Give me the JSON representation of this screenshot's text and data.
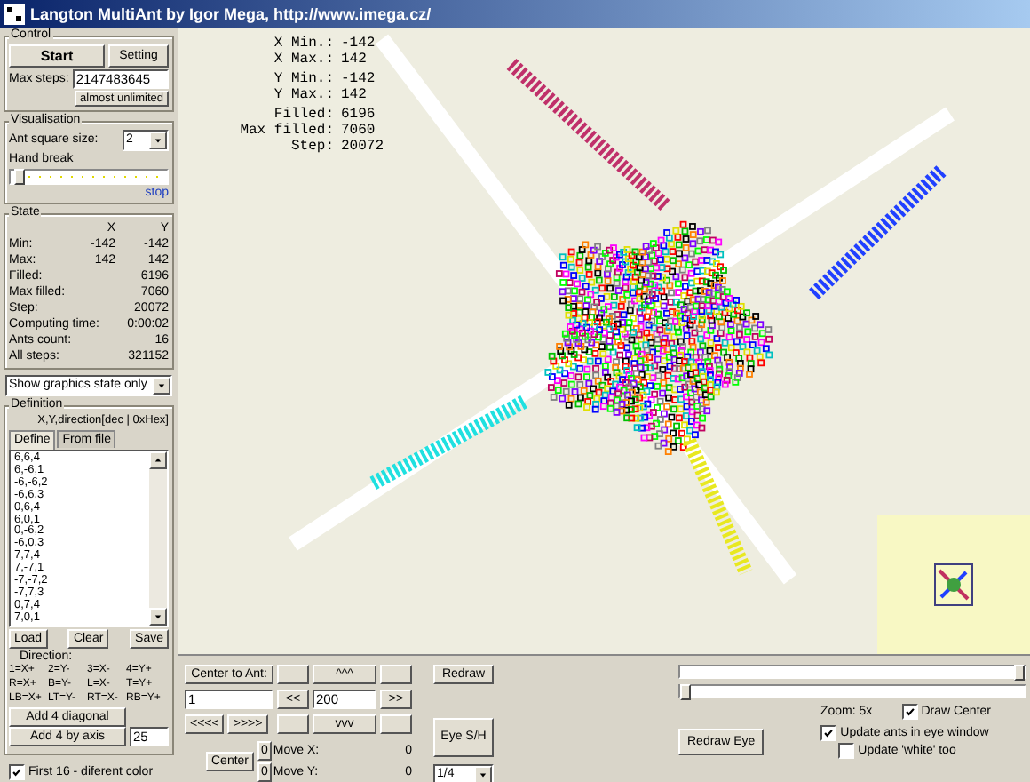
{
  "window": {
    "title": "Langton MultiAnt by Igor Mega, http://www.imega.cz/"
  },
  "control": {
    "title": "Control",
    "buttons": [
      "Start",
      "Setting"
    ],
    "max_steps": {
      "label": "Max steps:",
      "value": "2147483645"
    },
    "unlimited_button": "almost unlimited"
  },
  "visualisation": {
    "title": "Visualisation",
    "ant_size": {
      "label": "Ant square size:",
      "value": "2"
    },
    "hand_break": {
      "label": "Hand break",
      "level": 0.02,
      "link": "stop"
    }
  },
  "state": {
    "title": "State",
    "columns": [
      "X",
      "Y"
    ],
    "rows": [
      {
        "label": "Min:",
        "values": [
          "-142",
          "-142"
        ]
      },
      {
        "label": "Max:",
        "values": [
          "142",
          "142"
        ]
      },
      {
        "label": "Filled:",
        "values": [
          "6196"
        ]
      },
      {
        "label": "Max filled:",
        "values": [
          "7060"
        ]
      },
      {
        "label": "Step:",
        "values": [
          "20072"
        ]
      },
      {
        "label": "Computing time:",
        "values": [
          "0:00:02"
        ]
      },
      {
        "label": "Ants count:",
        "values": [
          "16"
        ]
      },
      {
        "label": "All steps:",
        "values": [
          "321152"
        ]
      }
    ],
    "mode": "Show graphics state only"
  },
  "definition": {
    "title": "Definition",
    "format": "X,Y,direction[dec | 0xHex]",
    "tabs": [
      {
        "label": "Define",
        "selected": true
      },
      {
        "label": "From file",
        "selected": false
      }
    ],
    "items": [
      "6,6,4",
      "6,-6,1",
      "-6,-6,2",
      "-6,6,3",
      "0,6,4",
      "6,0,1",
      "0,-6,2",
      "-6,0,3",
      "7,7,4",
      "7,-7,1",
      "-7,-7,2",
      "-7,7,3",
      "0,7,4",
      "7,0,1"
    ],
    "buttons": [
      "Load",
      "Clear",
      "Save"
    ],
    "direction_label": "Direction:",
    "directions": [
      [
        "1=X+",
        "2=Y-",
        "3=X-",
        "4=Y+"
      ],
      [
        "R=X+",
        "B=Y-",
        "L=X-",
        "T=Y+"
      ],
      [
        "LB=X+",
        "LT=Y-",
        "RT=X-",
        "RB=Y+"
      ]
    ],
    "add_buttons": [
      "Add 4 diagonal",
      "Add 4 by axis"
    ],
    "add_count": "25",
    "different_color": {
      "label": "First 16 - diferent color",
      "checked": true
    }
  },
  "canvas": {
    "stats": [
      {
        "label": "X Min.:",
        "value": "-142"
      },
      {
        "label": "X Max.:",
        "value": "142"
      },
      {
        "label": "Y Min.:",
        "value": "-142"
      },
      {
        "label": "Y Max.:",
        "value": "142"
      },
      {
        "label": "Filled:",
        "value": "6196"
      },
      {
        "label": "Max filled:",
        "value": "7060"
      },
      {
        "label": "Step:",
        "value": "20072"
      }
    ]
  },
  "navigation": {
    "center_to_ant": "Center to Ant:",
    "ant_number": "1",
    "prev": "<<<<",
    "next": ">>>>",
    "up": "^^^",
    "left": "<<",
    "step": "200",
    "right": ">>",
    "down": "vvv",
    "redraw": "Redraw",
    "eye_toggle": "Eye S/H",
    "center": "Center",
    "moves": [
      {
        "button": "0",
        "label": "Move X:",
        "value": "0"
      },
      {
        "button": "0",
        "label": "Move Y:",
        "value": "0"
      }
    ],
    "eye_scale": "1/4"
  },
  "eye": {
    "sliders": [
      {
        "level": 1
      },
      {
        "level": 0
      }
    ],
    "zoom": "Zoom: 5x",
    "draw_center": {
      "label": "Draw Center",
      "checked": true
    },
    "redraw_eye": "Redraw Eye",
    "update_ants": {
      "label": "Update ants in eye window",
      "checked": true
    },
    "update_white": {
      "label": "Update 'white' too",
      "checked": false
    }
  }
}
